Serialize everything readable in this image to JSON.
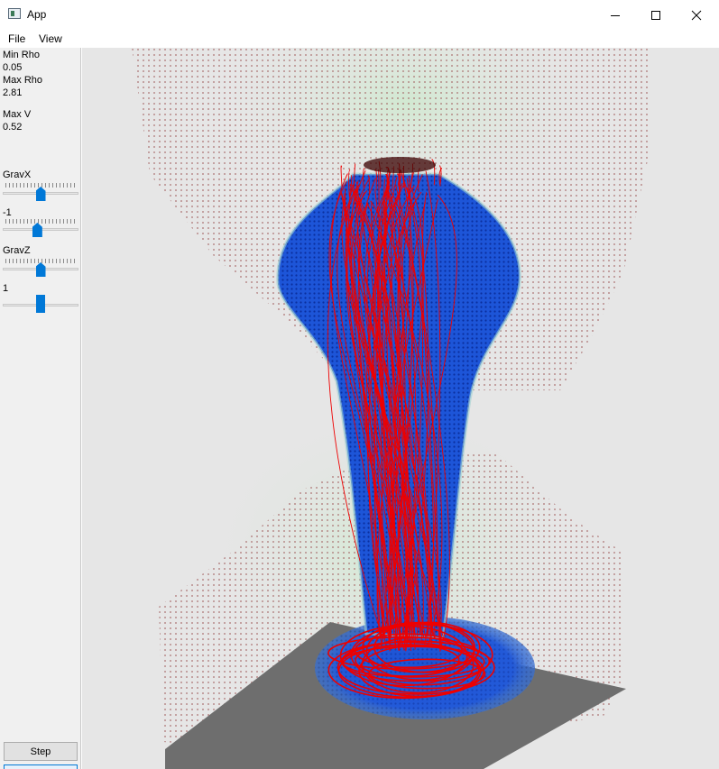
{
  "window": {
    "title": "App"
  },
  "menu": {
    "items": [
      "File",
      "View"
    ]
  },
  "sidebar": {
    "min_rho_label": "Min Rho",
    "min_rho_value": "0.05",
    "max_rho_label": "Max Rho",
    "max_rho_value": "2.81",
    "max_v_label": "Max V",
    "max_v_value": "0.52",
    "grav_x_label": "GravX",
    "grav_y_value": "-1",
    "grav_z_label": "GravZ",
    "fourth_value": "1"
  },
  "sliders": [
    {
      "name": "grav-x",
      "level": 0.5
    },
    {
      "name": "grav-y",
      "level": 0.45
    },
    {
      "name": "grav-z",
      "level": 0.5
    },
    {
      "name": "fourth",
      "level": 0.5
    }
  ],
  "step_button": {
    "label": "Step"
  },
  "colors": {
    "accent": "#0078d7",
    "fluid": "#1a4fd0",
    "streamline": "#ee0000",
    "boundary_dots": "#a05a5a",
    "floor": "#6e6e6e",
    "viewport_bg": "#e6e6e6"
  }
}
